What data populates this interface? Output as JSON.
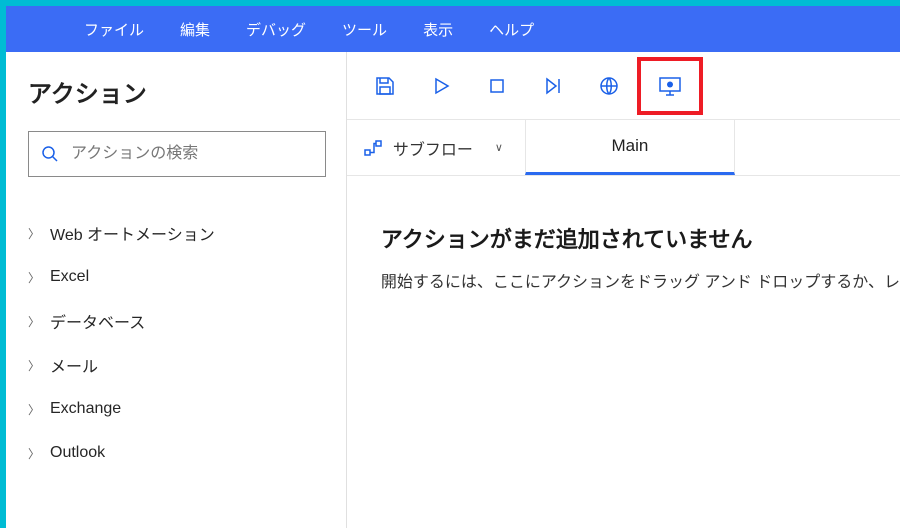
{
  "menu": {
    "file": "ファイル",
    "edit": "編集",
    "debug": "デバッグ",
    "tools": "ツール",
    "view": "表示",
    "help": "ヘルプ"
  },
  "sidebar": {
    "title": "アクション",
    "search_placeholder": "アクションの検索",
    "categories": [
      {
        "label": "Web オートメーション"
      },
      {
        "label": "Excel"
      },
      {
        "label": "データベース"
      },
      {
        "label": "メール"
      },
      {
        "label": "Exchange"
      },
      {
        "label": "Outlook"
      }
    ]
  },
  "tabs": {
    "subflow_label": "サブフロー",
    "main_label": "Main"
  },
  "empty_state": {
    "title": "アクションがまだ追加されていません",
    "subtitle": "開始するには、ここにアクションをドラッグ アンド ドロップするか、レ"
  }
}
